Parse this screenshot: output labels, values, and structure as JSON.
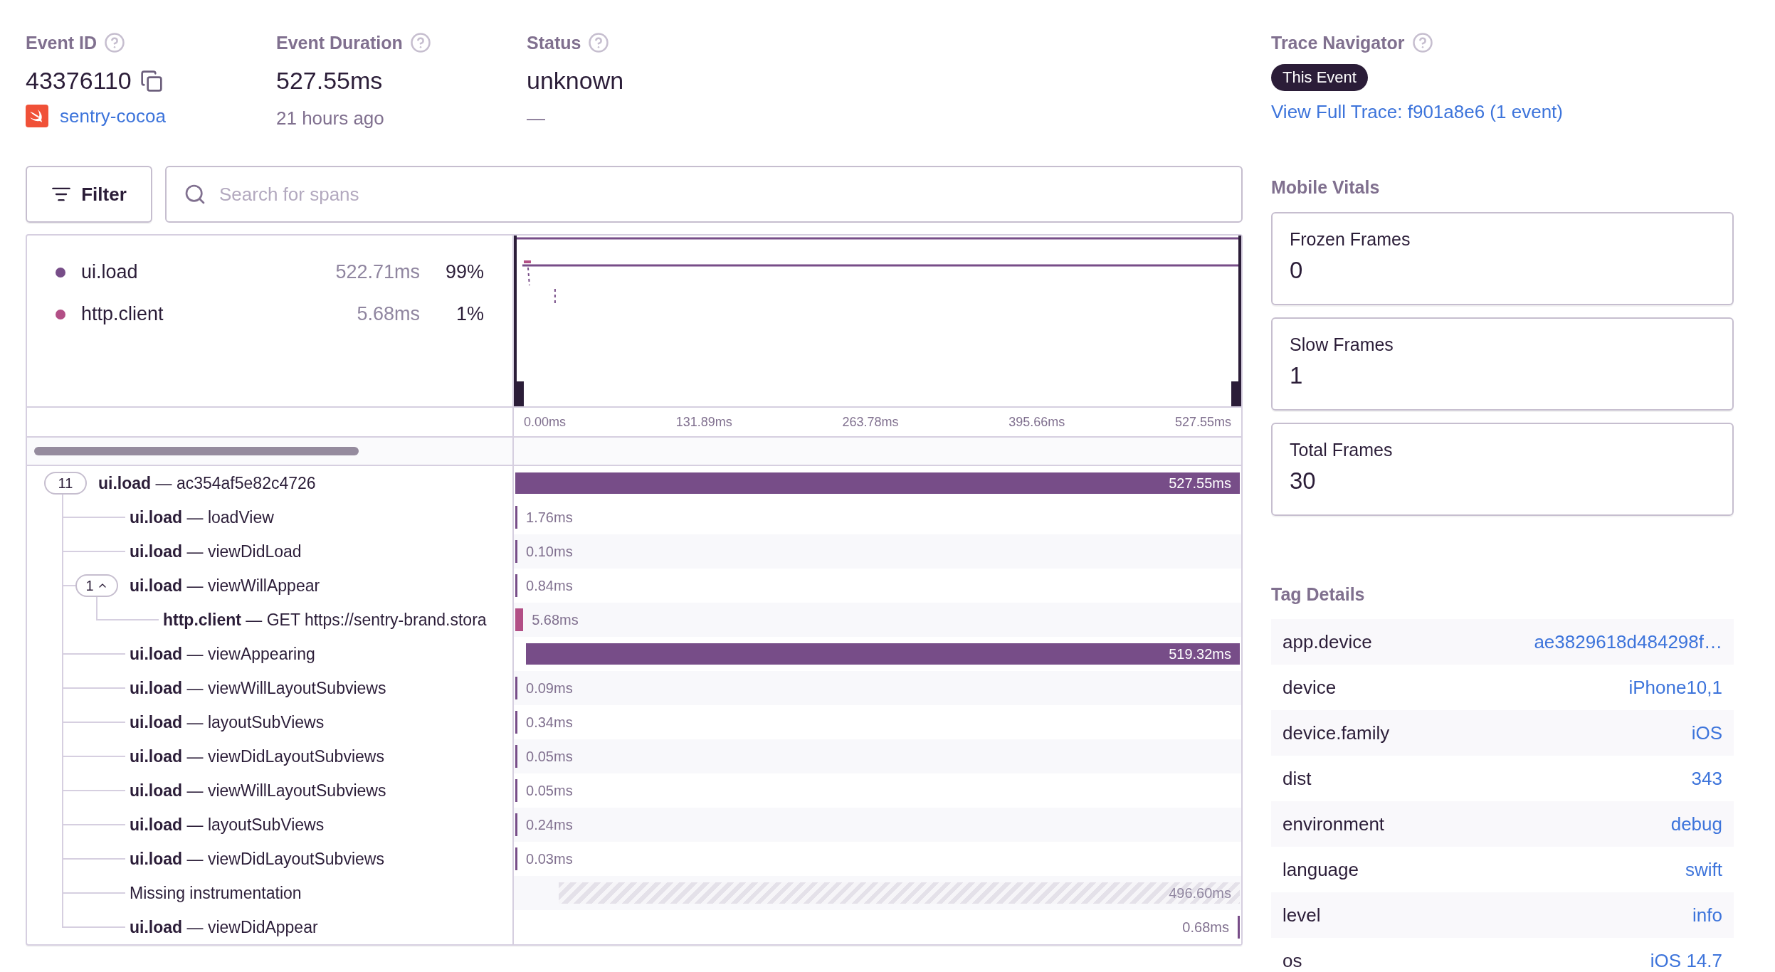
{
  "event_id": {
    "label": "Event ID",
    "value": "43376110",
    "project": "sentry-cocoa"
  },
  "duration": {
    "label": "Event Duration",
    "value": "527.55ms",
    "time": "21 hours ago"
  },
  "status": {
    "label": "Status",
    "value": "unknown",
    "detail": "—"
  },
  "filter": {
    "label": "Filter"
  },
  "search": {
    "placeholder": "Search for spans"
  },
  "minimap": {
    "legend": [
      {
        "op": "ui.load",
        "duration": "522.71ms",
        "percent": "99%",
        "color": "#774d88"
      },
      {
        "op": "http.client",
        "duration": "5.68ms",
        "percent": "1%",
        "color": "#b24f86"
      }
    ],
    "ticks": [
      "0.00ms",
      "131.89ms",
      "263.78ms",
      "395.66ms",
      "527.55ms"
    ]
  },
  "spans": [
    {
      "label": "**ui.load** — ac354af5e82c4726",
      "count": "11",
      "duration": "527.55ms",
      "kind": "bar",
      "level": 1,
      "color": "#774d88",
      "children": [
        {
          "label": "**ui.load** — loadView",
          "duration": "1.76ms",
          "kind": "tick",
          "align_end": false,
          "level": 0.003,
          "color": "#774d88"
        },
        {
          "label": "**ui.load** — viewDidLoad",
          "duration": "0.10ms",
          "kind": "tick",
          "align_end": false,
          "level": 0.003,
          "color": "#774d88"
        },
        {
          "label": "**ui.load** — viewWillAppear",
          "count": "1",
          "expanded": true,
          "duration": "0.84ms",
          "kind": "tick",
          "align_end": false,
          "level": 0.003,
          "color": "#774d88",
          "children": [
            {
              "label": "**http.client** — GET https://sentry-brand.stora",
              "duration": "5.68ms",
              "kind": "tick",
              "align_end": false,
              "level": 0.011,
              "color": "#b24f86"
            }
          ]
        },
        {
          "label": "**ui.load** — viewAppearing",
          "duration": "519.32ms",
          "kind": "bar",
          "align_end": true,
          "level": 0.985,
          "color": "#774d88"
        },
        {
          "label": "**ui.load** — viewWillLayoutSubviews",
          "duration": "0.09ms",
          "kind": "tick",
          "align_end": false,
          "level": 0.003,
          "color": "#774d88"
        },
        {
          "label": "**ui.load** — layoutSubViews",
          "duration": "0.34ms",
          "kind": "tick",
          "align_end": false,
          "level": 0.003,
          "color": "#774d88"
        },
        {
          "label": "**ui.load** — viewDidLayoutSubviews",
          "duration": "0.05ms",
          "kind": "tick",
          "align_end": false,
          "level": 0.003,
          "color": "#774d88"
        },
        {
          "label": "**ui.load** — viewWillLayoutSubviews",
          "duration": "0.05ms",
          "kind": "tick",
          "align_end": false,
          "level": 0.003,
          "color": "#774d88"
        },
        {
          "label": "**ui.load** — layoutSubViews",
          "duration": "0.24ms",
          "kind": "tick",
          "align_end": false,
          "level": 0.003,
          "color": "#774d88"
        },
        {
          "label": "**ui.load** — viewDidLayoutSubviews",
          "duration": "0.03ms",
          "kind": "tick",
          "align_end": false,
          "level": 0.003,
          "color": "#774d88"
        },
        {
          "label": "Missing instrumentation",
          "duration": "496.60ms",
          "kind": "missing",
          "align_end": true,
          "level": 0.94
        },
        {
          "label": "**ui.load** — viewDidAppear",
          "duration": "0.68ms",
          "kind": "tick",
          "align_end": true,
          "level": 0.003,
          "color": "#774d88"
        }
      ]
    }
  ],
  "trace_navigator": {
    "label": "Trace Navigator",
    "badge": "This Event",
    "link": "View Full Trace: f901a8e6 (1 event)"
  },
  "mobile_vitals": {
    "title": "Mobile Vitals",
    "cards": [
      {
        "label": "Frozen Frames",
        "value": "0"
      },
      {
        "label": "Slow Frames",
        "value": "1"
      },
      {
        "label": "Total Frames",
        "value": "30"
      }
    ]
  },
  "tag_details": {
    "title": "Tag Details",
    "rows": [
      {
        "key": "app.device",
        "value": "ae3829618d484298f…"
      },
      {
        "key": "device",
        "value": "iPhone10,1"
      },
      {
        "key": "device.family",
        "value": "iOS"
      },
      {
        "key": "dist",
        "value": "343"
      },
      {
        "key": "environment",
        "value": "debug"
      },
      {
        "key": "language",
        "value": "swift"
      },
      {
        "key": "level",
        "value": "info"
      },
      {
        "key": "os",
        "value": "iOS 14.7"
      }
    ]
  }
}
